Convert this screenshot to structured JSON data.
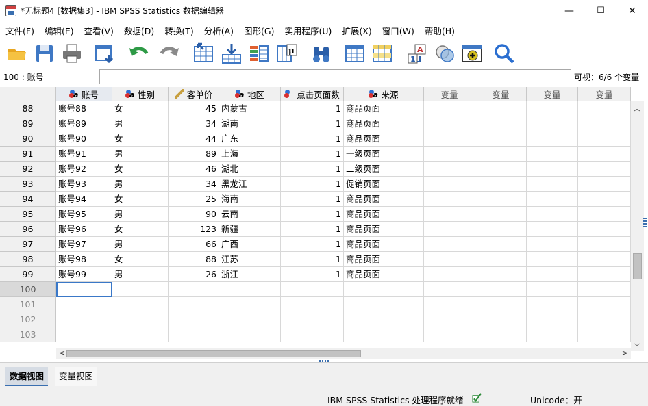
{
  "window": {
    "title": "*无标题4 [数据集3] - IBM SPSS Statistics 数据编辑器",
    "minimize": "—",
    "maximize": "☐",
    "close": "✕"
  },
  "menu": [
    "文件(F)",
    "编辑(E)",
    "查看(V)",
    "数据(D)",
    "转换(T)",
    "分析(A)",
    "图形(G)",
    "实用程序(U)",
    "扩展(X)",
    "窗口(W)",
    "帮助(H)"
  ],
  "toolbar": {
    "icons": [
      "open-folder-icon",
      "save-icon",
      "print-icon",
      "recall-dialog-icon",
      "undo-icon",
      "redo-icon",
      "goto-case-icon",
      "goto-variable-icon",
      "variables-icon",
      "run-descriptives-icon",
      "find-icon",
      "insert-cases-icon",
      "insert-variable-icon",
      "split-file-icon",
      "weight-cases-icon",
      "select-cases-icon",
      "value-labels-icon",
      "use-variable-sets-icon",
      "spelling-icon"
    ]
  },
  "cellbar": {
    "cell_ref": "100 : 账号",
    "value": "",
    "visible_count": "可视：6/6 个变量"
  },
  "grid": {
    "columns": [
      {
        "label": "账号",
        "icon": "nominal-string-icon"
      },
      {
        "label": "性别",
        "icon": "nominal-string-icon"
      },
      {
        "label": "客单价",
        "icon": "scale-ruler-icon"
      },
      {
        "label": "地区",
        "icon": "nominal-string-icon"
      },
      {
        "label": "点击页面数",
        "icon": "nominal-icon"
      },
      {
        "label": "来源",
        "icon": "nominal-string-icon"
      },
      {
        "label": "变量",
        "icon": ""
      },
      {
        "label": "变量",
        "icon": ""
      },
      {
        "label": "变量",
        "icon": ""
      },
      {
        "label": "变量",
        "icon": ""
      }
    ],
    "rows": [
      {
        "n": "88",
        "cells": [
          "账号88",
          "女",
          "45",
          "内蒙古",
          "1",
          "商品页面"
        ]
      },
      {
        "n": "89",
        "cells": [
          "账号89",
          "男",
          "34",
          "湖南",
          "1",
          "商品页面"
        ]
      },
      {
        "n": "90",
        "cells": [
          "账号90",
          "女",
          "44",
          "广东",
          "1",
          "商品页面"
        ]
      },
      {
        "n": "91",
        "cells": [
          "账号91",
          "男",
          "89",
          "上海",
          "1",
          "一级页面"
        ]
      },
      {
        "n": "92",
        "cells": [
          "账号92",
          "女",
          "46",
          "湖北",
          "1",
          "二级页面"
        ]
      },
      {
        "n": "93",
        "cells": [
          "账号93",
          "男",
          "34",
          "黑龙江",
          "1",
          "促销页面"
        ]
      },
      {
        "n": "94",
        "cells": [
          "账号94",
          "女",
          "25",
          "海南",
          "1",
          "商品页面"
        ]
      },
      {
        "n": "95",
        "cells": [
          "账号95",
          "男",
          "90",
          "云南",
          "1",
          "商品页面"
        ]
      },
      {
        "n": "96",
        "cells": [
          "账号96",
          "女",
          "123",
          "新疆",
          "1",
          "商品页面"
        ]
      },
      {
        "n": "97",
        "cells": [
          "账号97",
          "男",
          "66",
          "广西",
          "1",
          "商品页面"
        ]
      },
      {
        "n": "98",
        "cells": [
          "账号98",
          "女",
          "88",
          "江苏",
          "1",
          "商品页面"
        ]
      },
      {
        "n": "99",
        "cells": [
          "账号99",
          "男",
          "26",
          "浙江",
          "1",
          "商品页面"
        ]
      },
      {
        "n": "100",
        "cells": [
          "",
          "",
          "",
          "",
          "",
          ""
        ]
      },
      {
        "n": "101",
        "cells": [
          "",
          "",
          "",
          "",
          "",
          ""
        ]
      },
      {
        "n": "102",
        "cells": [
          "",
          "",
          "",
          "",
          "",
          ""
        ]
      },
      {
        "n": "103",
        "cells": [
          "",
          "",
          "",
          "",
          "",
          ""
        ]
      }
    ]
  },
  "tabs": {
    "data_view": "数据视图",
    "variable_view": "变量视图"
  },
  "status": {
    "processor": "IBM SPSS Statistics 处理程序就绪",
    "unicode": "Unicode：开"
  }
}
